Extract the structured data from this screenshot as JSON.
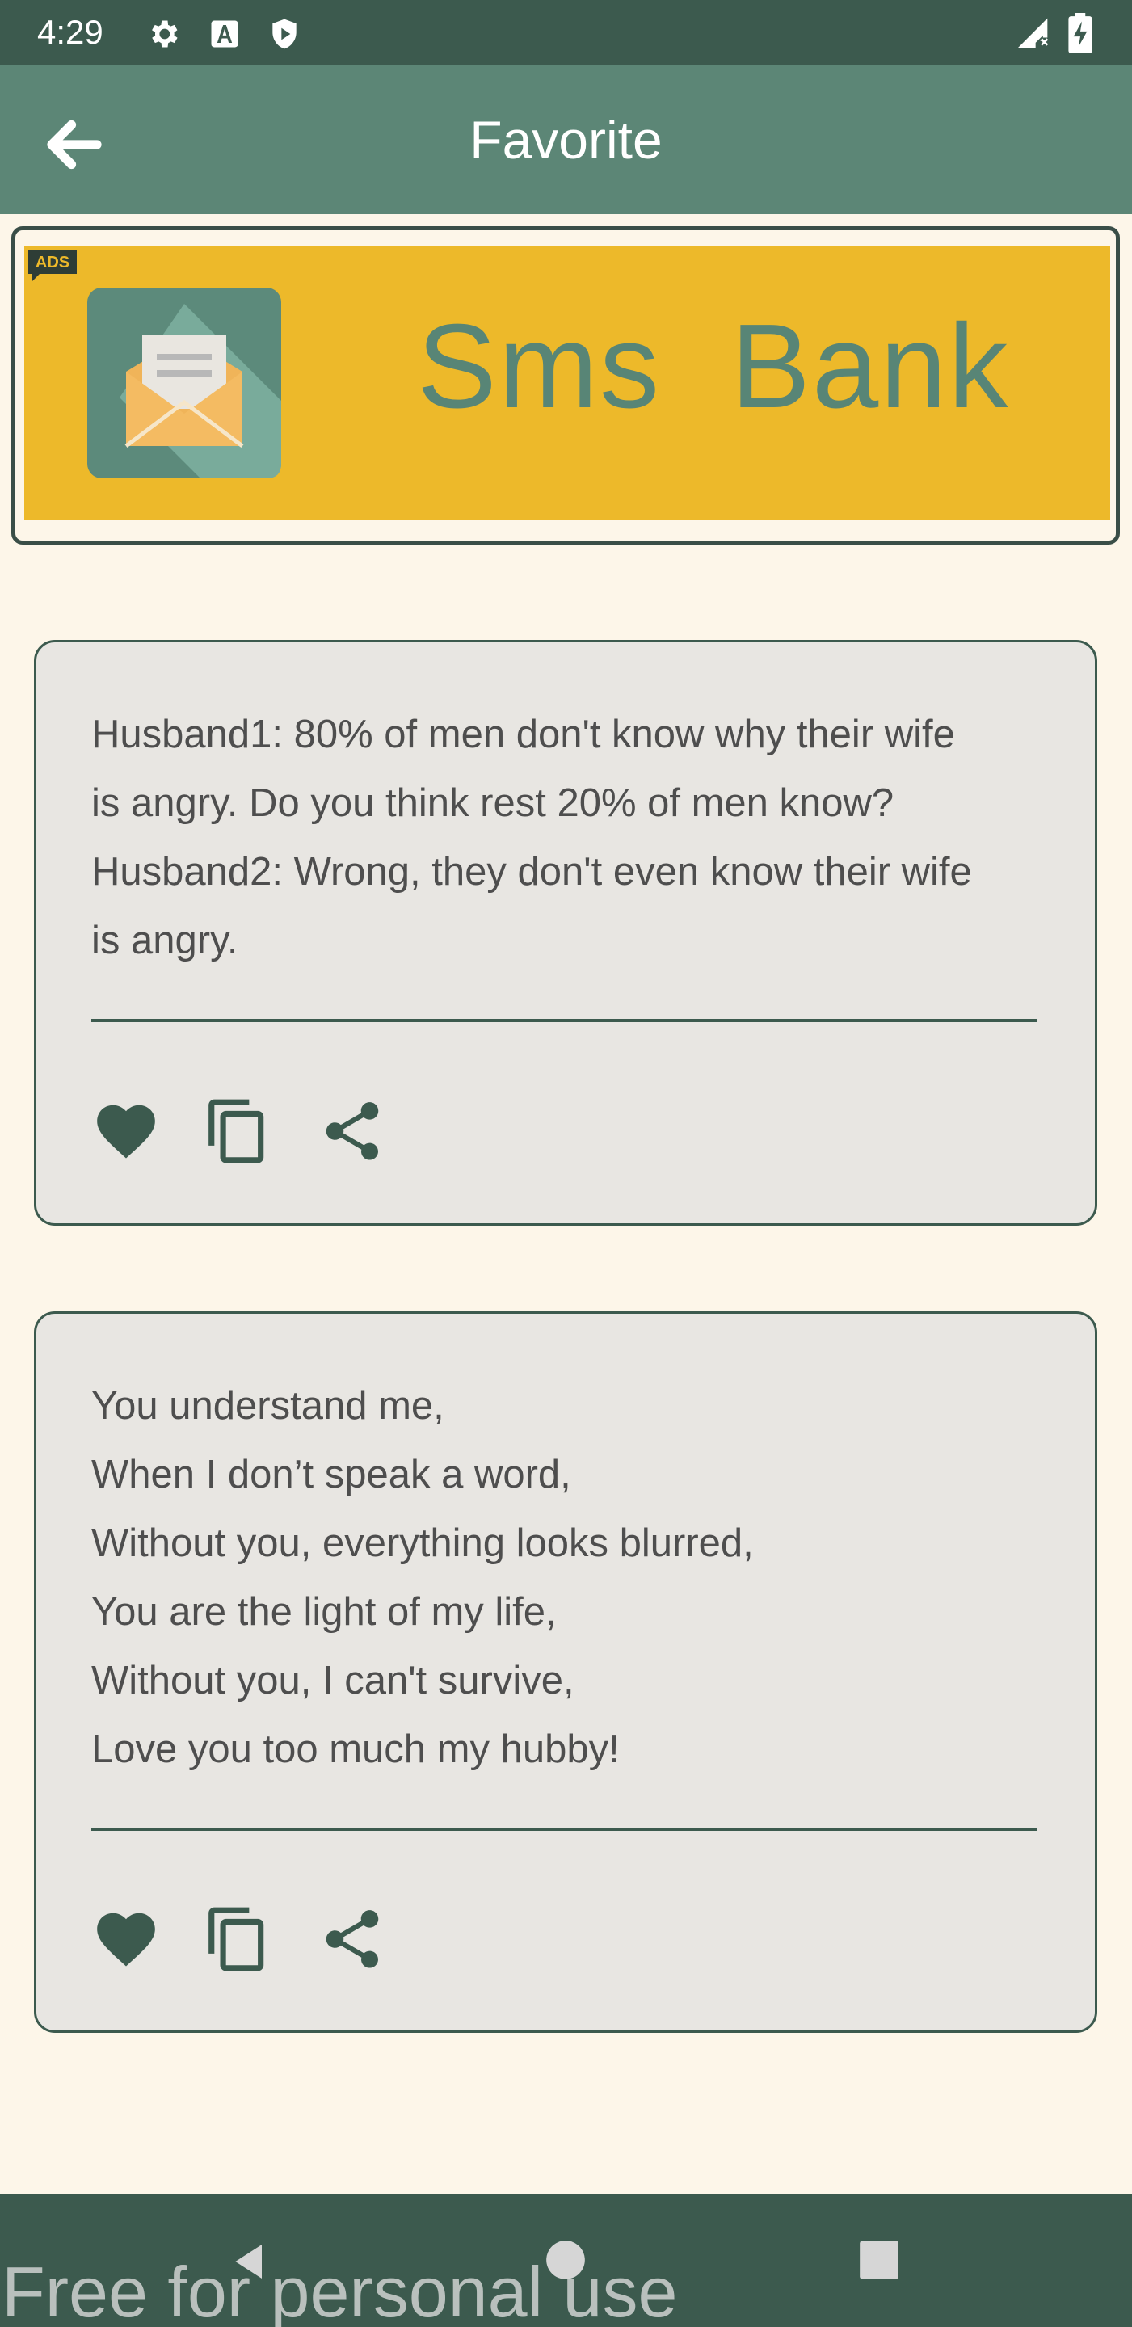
{
  "status_bar": {
    "time": "4:29",
    "icons": [
      "gear-icon",
      "font-icon",
      "shield-icon"
    ],
    "right_icons": [
      "signal-no-data-icon",
      "battery-charging-icon"
    ]
  },
  "app_bar": {
    "back_icon": "arrow-left-icon",
    "title": "Favorite"
  },
  "ad": {
    "tag": "ADS",
    "icon": "envelope-icon",
    "text": "Sms  Bank",
    "colors": {
      "background": "#edb92a",
      "text": "#588576"
    }
  },
  "cards": [
    {
      "lines": [
        "Husband1: 80% of men don't know why their wife",
        "is angry. Do you think rest 20% of men know?",
        "Husband2: Wrong, they don't even know their wife",
        "is angry."
      ],
      "actions": [
        "heart-icon",
        "copy-icon",
        "share-icon"
      ]
    },
    {
      "lines": [
        "You understand me,",
        "When I don’t speak a word,",
        "Without you, everything looks blurred,",
        "You are the light of my life,",
        "Without you, I can't survive,",
        "Love you too much my hubby!"
      ],
      "actions": [
        "heart-icon",
        "copy-icon",
        "share-icon"
      ]
    }
  ],
  "nav_bar": {
    "buttons": [
      "back-triangle-icon",
      "home-circle-icon",
      "recents-square-icon"
    ]
  },
  "watermark": "Free for personal use",
  "colors": {
    "primary_dark": "#3c5a4e",
    "primary": "#5c8676",
    "page_background": "#fdf6e9",
    "card_background": "#e8e6e2"
  }
}
